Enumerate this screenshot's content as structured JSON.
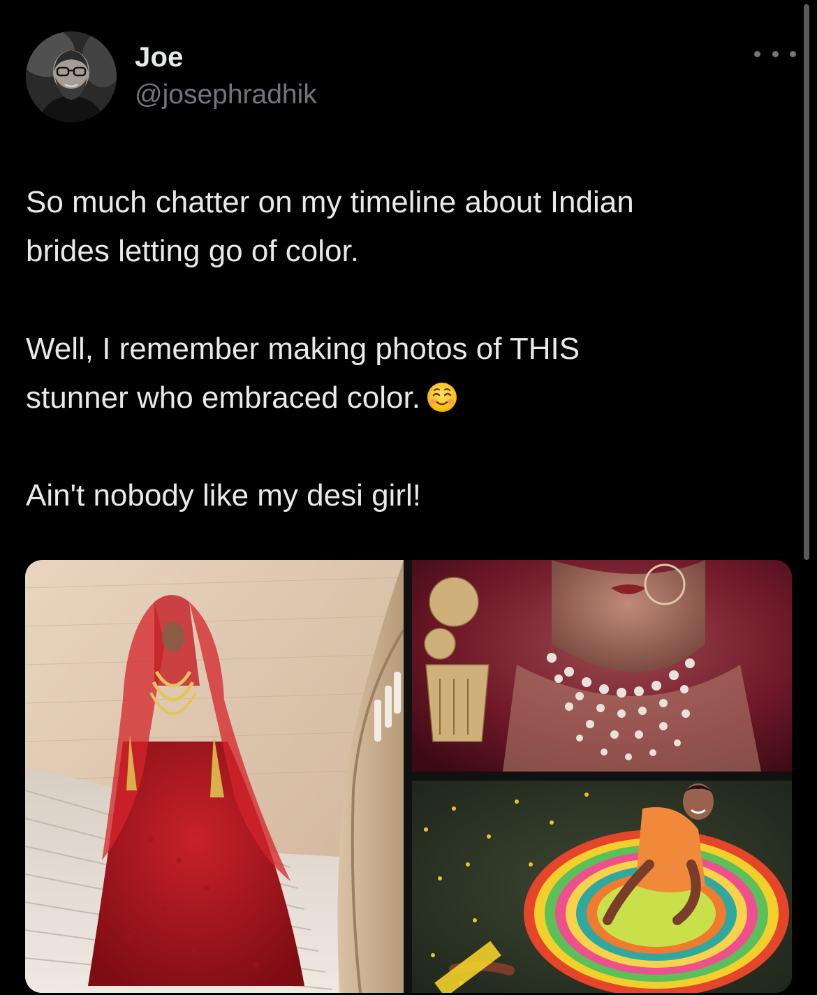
{
  "author": {
    "display_name": "Joe",
    "handle": "@josephradhik"
  },
  "tweet": {
    "line1": "So much chatter on my timeline about Indian",
    "line2": "brides letting go of color.",
    "line3": "Well, I remember making photos of THIS",
    "line4": "stunner who embraced color.",
    "emoji": "smiling-face-icon",
    "line5": "Ain't nobody like my desi girl!"
  },
  "icons": {
    "more": "more-options-icon",
    "emoji": "smiling-face-icon"
  },
  "colors": {
    "background": "#000000",
    "text": "#e7e9ea",
    "secondary_text": "#71767b",
    "bridal_red": "#b3121b"
  }
}
